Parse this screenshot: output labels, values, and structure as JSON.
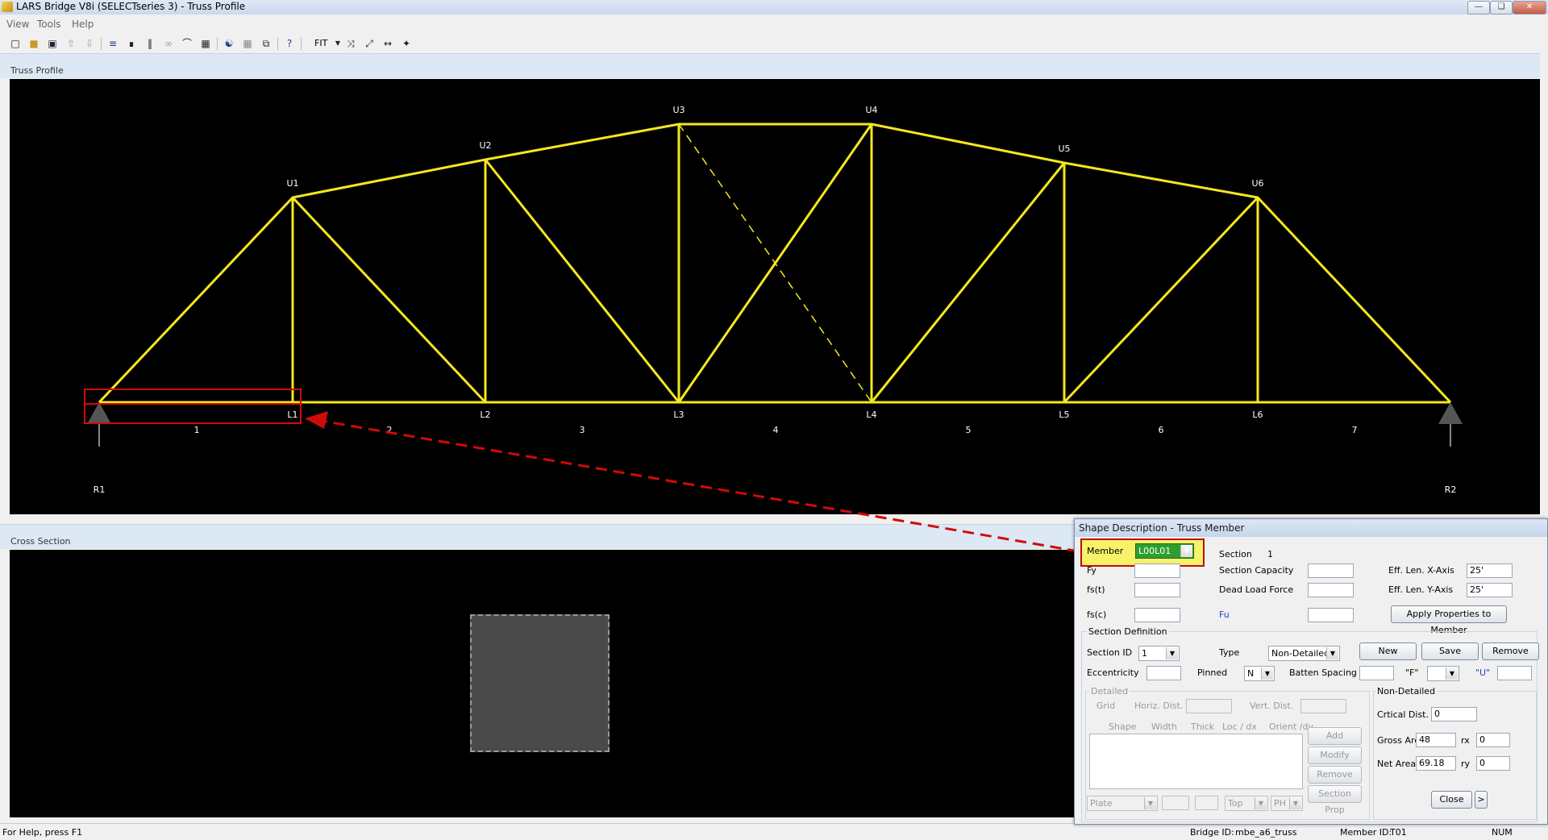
{
  "window": {
    "title": "LARS Bridge V8i (SELECTseries 3) - Truss Profile"
  },
  "menu": [
    "View",
    "Tools",
    "Help"
  ],
  "toolbar": {
    "icons": [
      "new-file-icon",
      "open-folder-icon",
      "save-icon",
      "up-arrow-icon",
      "down-arrow-icon",
      "truss-icon",
      "member-icon",
      "vertical-icon",
      "link-icon",
      "arch-icon",
      "bridge-icon",
      "person-icon",
      "grid-icon",
      "copy-icon",
      "help-pointer-icon"
    ],
    "zoom_label": "FIT"
  },
  "truss_profile": {
    "heading": "Truss Profile",
    "upper_nodes": [
      "U1",
      "U2",
      "U3",
      "U4",
      "U5",
      "U6"
    ],
    "lower_nodes": [
      "L1",
      "L2",
      "L3",
      "L4",
      "L5",
      "L6"
    ],
    "panels": [
      "1",
      "2",
      "3",
      "4",
      "5",
      "6",
      "7"
    ],
    "supports": [
      "R1",
      "R2"
    ],
    "line_color": "#f5e71e",
    "highlight_color": "#d10a0a"
  },
  "cross_section": {
    "heading": "Cross Section",
    "shape_color": "#4a4a4a"
  },
  "status": {
    "help": "For Help, press F1",
    "bridge_label": "Bridge ID:",
    "bridge_id": "mbe_a6_truss",
    "member_label": "Member ID:",
    "member_id": "T01",
    "num": "NUM"
  },
  "dialog": {
    "title": "Shape Description - Truss Member",
    "member_label": "Member",
    "member_value": "L00L01",
    "section_label": "Section",
    "section_value": "1",
    "fy_label": "Fy",
    "fst_label": "fs(t)",
    "fsc_label": "fs(c)",
    "section_capacity_label": "Section Capacity",
    "dead_load_label": "Dead Load Force",
    "fu_label": "Fu",
    "eff_x_label": "Eff. Len. X-Axis",
    "eff_x_value": "25'",
    "eff_y_label": "Eff. Len. Y-Axis",
    "eff_y_value": "25'",
    "apply_button": "Apply Properties to Member",
    "section_def_title": "Section Definition",
    "section_id_label": "Section ID",
    "section_id_value": "1",
    "type_label": "Type",
    "type_value": "Non-Detailed",
    "new_button": "New",
    "save_button": "Save",
    "remove_button": "Remove",
    "eccentricity_label": "Eccentricity",
    "pinned_label": "Pinned",
    "pinned_value": "N",
    "batten_label": "Batten Spacing",
    "f_label": "\"F\"",
    "u_label": "\"U\"",
    "detailed_title": "Detailed",
    "grid_label": "Grid",
    "horiz_label": "Horiz. Dist.",
    "vert_label": "Vert. Dist.",
    "shape_col": "Shape",
    "width_col": "Width",
    "thick_col": "Thick",
    "loc_col": "Loc / dx",
    "orient_col": "Orient /dy",
    "add_button": "Add",
    "modify_button": "Modify",
    "remove2_button": "Remove",
    "section_prop_button": "Section Prop",
    "plate_value": "Plate",
    "top_value": "Top",
    "ph_value": "PH",
    "nondetailed_title": "Non-Detailed",
    "critical_label": "Crtical Dist.",
    "critical_value": "0",
    "gross_label": "Gross Area",
    "gross_value": "48",
    "rx_label": "rx",
    "rx_value": "0",
    "net_label": "Net Area",
    "net_value": "69.18",
    "ry_label": "ry",
    "ry_value": "0",
    "close_button": "Close",
    "more_button": ">"
  }
}
